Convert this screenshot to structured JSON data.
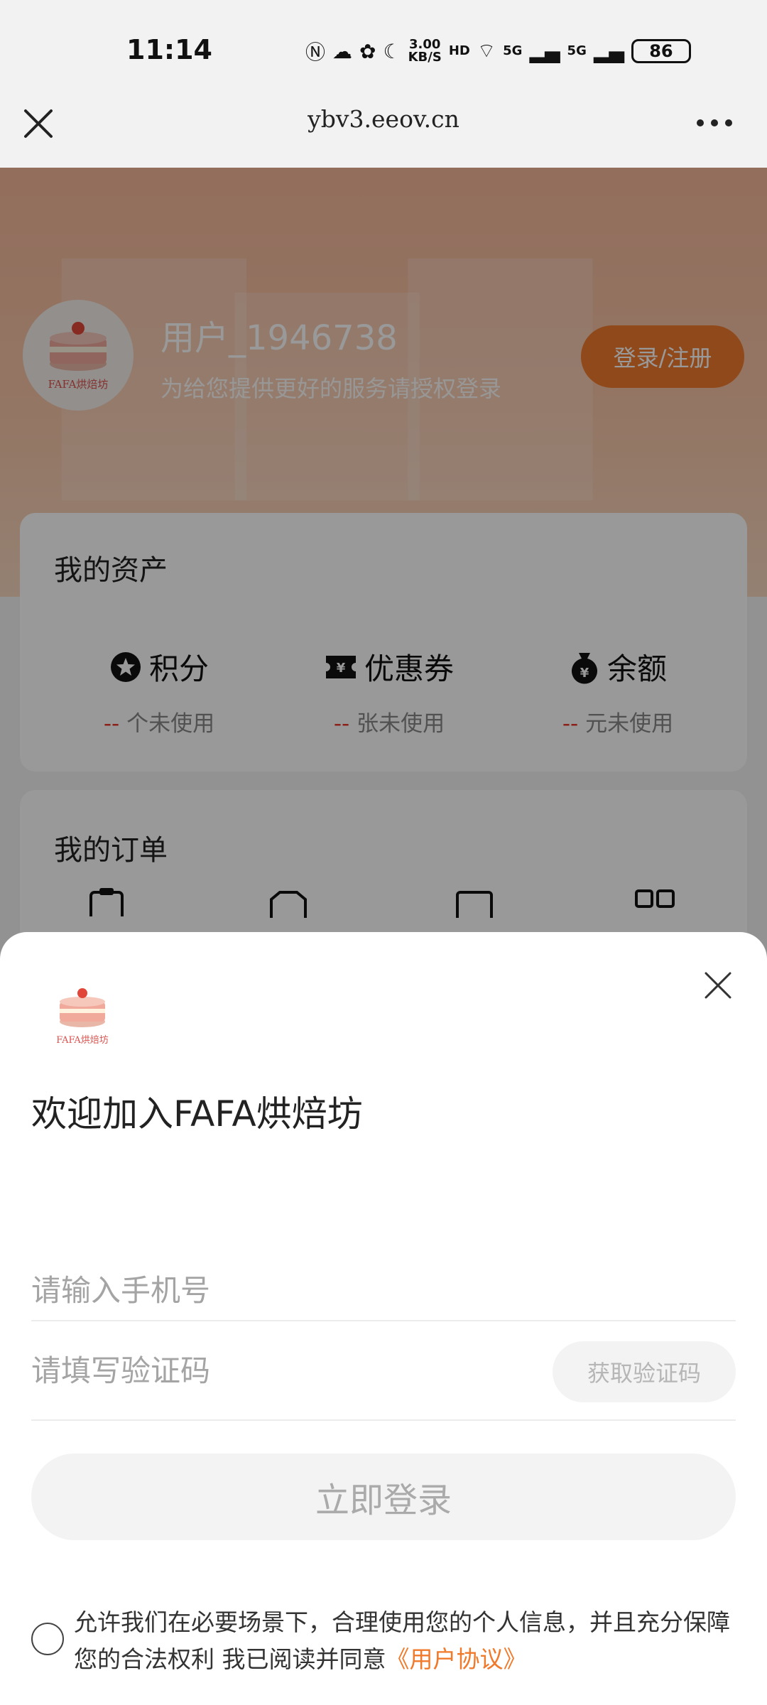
{
  "status_bar": {
    "time": "11:14",
    "net_speed_value": "3.00",
    "net_speed_unit": "KB/S",
    "hd": "HD",
    "signal_1": "5G",
    "signal_2": "5G",
    "battery": "86"
  },
  "browser": {
    "url": "ybv3.eeov.cn"
  },
  "profile": {
    "logo_text": "FAFA烘焙坊",
    "username": "用户_1946738",
    "subtitle": "为给您提供更好的服务请授权登录",
    "login_button": "登录/注册"
  },
  "assets": {
    "title": "我的资产",
    "items": [
      {
        "icon": "star-badge-icon",
        "label": "积分",
        "value": "--",
        "suffix": "个未使用"
      },
      {
        "icon": "coupon-icon",
        "label": "优惠券",
        "value": "--",
        "suffix": "张未使用"
      },
      {
        "icon": "money-bag-icon",
        "label": "余额",
        "value": "--",
        "suffix": "元未使用"
      }
    ]
  },
  "orders": {
    "title": "我的订单"
  },
  "login_sheet": {
    "logo_text": "FAFA烘焙坊",
    "welcome": "欢迎加入FAFA烘焙坊",
    "phone_placeholder": "请输入手机号",
    "code_placeholder": "请填写验证码",
    "get_code_button": "获取验证码",
    "submit_button": "立即登录",
    "agreement_text": "允许我们在必要场景下，合理使用您的个人信息，并且充分保障您的合法权利  我已阅读并同意",
    "agreement_link": "《用户协议》"
  },
  "colors": {
    "accent": "#f07a2c",
    "hero": "#f5b79a",
    "dash": "#e83828"
  }
}
